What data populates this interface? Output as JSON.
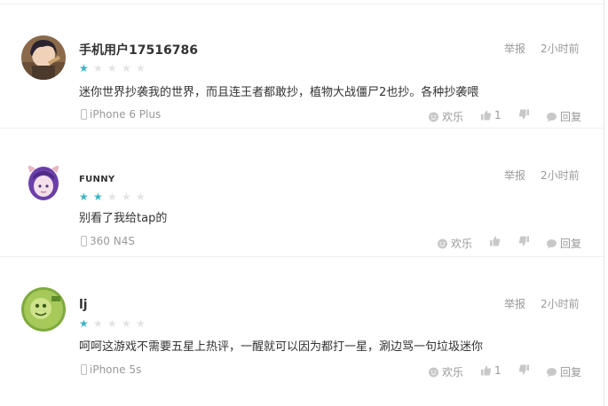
{
  "reviews": [
    {
      "username": "手机用户17516786",
      "rating": 1,
      "report_label": "举报",
      "time": "2小时前",
      "content": "迷你世界抄袭我的世界，而且连王者都敢抄，植物大战僵尸2也抄。各种抄袭喂",
      "device": "iPhone 6 Plus",
      "fun_label": "欢乐",
      "like_count": "1",
      "reply_label": "回复"
    },
    {
      "username": "FUNNY",
      "rating": 2,
      "report_label": "举报",
      "time": "2小时前",
      "content": "别看了我给tap的",
      "device": "360 N4S",
      "fun_label": "欢乐",
      "like_count": "",
      "reply_label": "回复"
    },
    {
      "username": "lj",
      "rating": 1,
      "report_label": "举报",
      "time": "2小时前",
      "content": "呵呵这游戏不需要五星上热评，一醒就可以因为都打一星，涮边骂一句垃圾迷你",
      "device": "iPhone 5s",
      "fun_label": "欢乐",
      "like_count": "1",
      "reply_label": "回复"
    }
  ],
  "colors": {
    "star_on": "#3bb4c1",
    "star_off": "#e3e3e3",
    "meta_text": "#999999"
  }
}
